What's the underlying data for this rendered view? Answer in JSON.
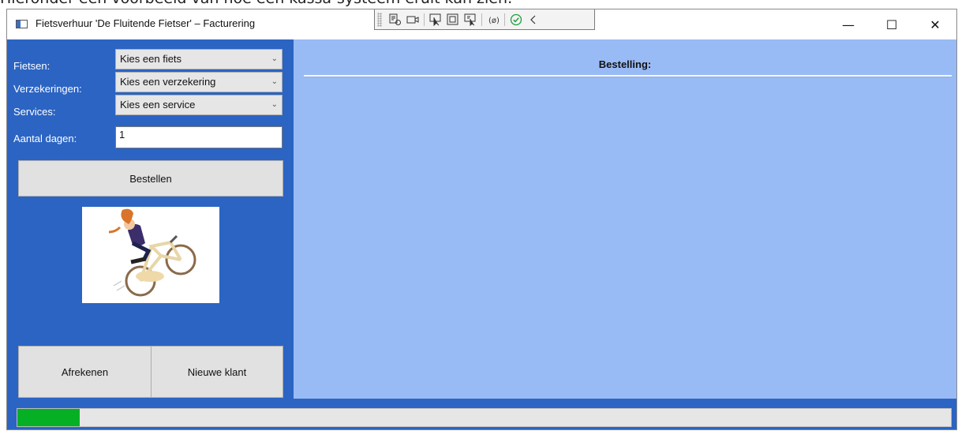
{
  "document": {
    "caption": "Hieronder een voorbeeld van hoe een kassa-systeem eruit kan zien:"
  },
  "window": {
    "title": "Fietsverhuur 'De Fluitende Fietser' – Facturering",
    "controls": {
      "minimize": "—",
      "maximize": "☐",
      "close": "✕"
    }
  },
  "debug_toolbar": {
    "icons": [
      "select-element-icon",
      "track-focus-icon",
      "select-pointer-icon",
      "layout-adorner-icon",
      "live-preview-icon",
      "binding-icon",
      "check-icon",
      "collapse-icon"
    ]
  },
  "form": {
    "labels": {
      "bikes": "Fietsen:",
      "insurances": "Verzekeringen:",
      "services": "Services:",
      "days": "Aantal dagen:"
    },
    "bikes_value": "Kies een fiets",
    "insurances_value": "Kies een verzekering",
    "services_value": "Kies een service",
    "days_value": "1",
    "order_button": "Bestellen",
    "checkout_button": "Afrekenen",
    "new_customer_button": "Nieuwe klant"
  },
  "order": {
    "title": "Bestelling:"
  },
  "progress": {
    "fraction": 0.067,
    "color": "#06b025"
  },
  "colors": {
    "left_panel": "#2b64c3",
    "right_panel": "#99bbf5"
  }
}
